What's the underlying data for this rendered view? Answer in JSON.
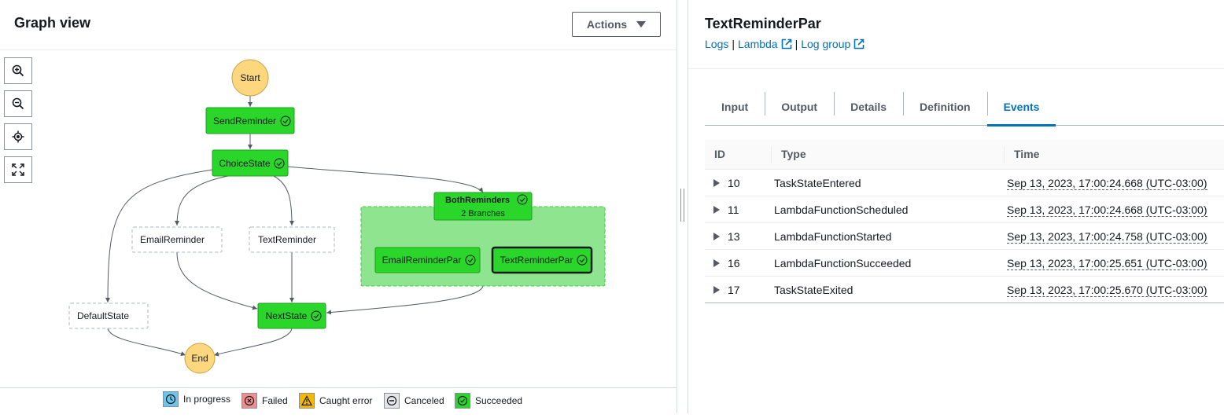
{
  "graph_panel": {
    "title": "Graph view",
    "actions_label": "Actions",
    "zoom_controls": [
      {
        "name": "zoom-in-icon"
      },
      {
        "name": "zoom-out-icon"
      },
      {
        "name": "center-icon"
      },
      {
        "name": "fit-to-screen-icon"
      }
    ],
    "nodes": {
      "start": "Start",
      "send_reminder": "SendReminder",
      "choice_state": "ChoiceState",
      "email_reminder": "EmailReminder",
      "text_reminder": "TextReminder",
      "both_reminders": "BothReminders",
      "both_reminders_sub": "2 Branches",
      "email_reminder_par": "EmailReminderPar",
      "text_reminder_par": "TextReminderPar",
      "default_state": "DefaultState",
      "next_state": "NextState",
      "end": "End"
    },
    "legend": [
      {
        "label": "In progress",
        "color": "#6bc5ea",
        "icon": "clock-icon"
      },
      {
        "label": "Failed",
        "color": "#f38d8d",
        "icon": "x-circle-icon"
      },
      {
        "label": "Caught error",
        "color": "#f5b800",
        "icon": "warning-icon"
      },
      {
        "label": "Canceled",
        "color": "#e5e5e5",
        "icon": "minus-circle-icon"
      },
      {
        "label": "Succeeded",
        "color": "#2bd62b",
        "icon": "check-circle-icon"
      }
    ],
    "colors": {
      "succeeded": "#2bd62b",
      "start_end": "#fdd77e",
      "parallel_bg": "#8fe58f",
      "edge": "#545b64"
    }
  },
  "detail_panel": {
    "title": "TextReminderPar",
    "links": {
      "logs": "Logs",
      "lambda": "Lambda",
      "log_group": "Log group",
      "separator": "|"
    },
    "tabs": [
      {
        "label": "Input"
      },
      {
        "label": "Output"
      },
      {
        "label": "Details"
      },
      {
        "label": "Definition"
      },
      {
        "label": "Events",
        "active": true
      }
    ],
    "events_table": {
      "columns": [
        "ID",
        "Type",
        "Time"
      ],
      "rows": [
        {
          "id": "10",
          "type": "TaskStateEntered",
          "time": "Sep 13, 2023, 17:00:24.668 (UTC-03:00)"
        },
        {
          "id": "11",
          "type": "LambdaFunctionScheduled",
          "time": "Sep 13, 2023, 17:00:24.668 (UTC-03:00)"
        },
        {
          "id": "13",
          "type": "LambdaFunctionStarted",
          "time": "Sep 13, 2023, 17:00:24.758 (UTC-03:00)"
        },
        {
          "id": "16",
          "type": "LambdaFunctionSucceeded",
          "time": "Sep 13, 2023, 17:00:25.651 (UTC-03:00)"
        },
        {
          "id": "17",
          "type": "TaskStateExited",
          "time": "Sep 13, 2023, 17:00:25.670 (UTC-03:00)"
        }
      ]
    }
  }
}
